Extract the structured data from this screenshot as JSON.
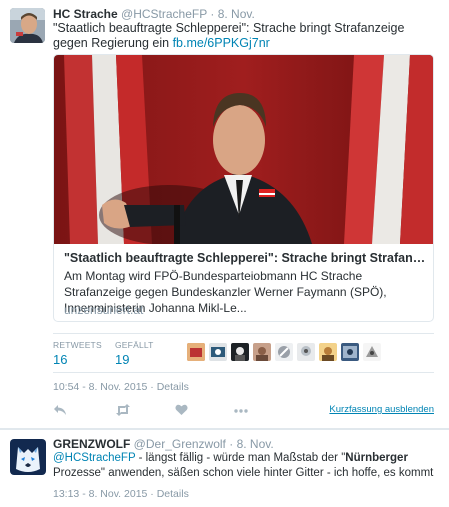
{
  "tweet": {
    "name": "HC Strache",
    "handle": "@HCStracheFP",
    "dot": "·",
    "date": "8. Nov.",
    "text": "\"Staatlich beauftragte Schlepperei\": Strache bringt Strafanzeige gegen Regierung ein",
    "link": "fb.me/6PPKGj7nr",
    "card": {
      "title": "\"Staatlich beauftragte Schlepperei\": Strache bringt Strafanzeige geg...",
      "description": "Am Montag wird FPÖ-Bundesparteiobmann HC Strache Strafanzeige gegen Bundeskanzler Werner Faymann (SPÖ), Innenministerin Johanna Mikl-Le...",
      "domain": "unzensuriert.at"
    },
    "stats": {
      "retweets_label": "RETWEETS",
      "retweets_value": "16",
      "likes_label": "GEFÄLLT",
      "likes_value": "19"
    },
    "timestamp": "10:54 - 8. Nov. 2015",
    "details": "Details",
    "collapse": "Kurzfassung ausblenden"
  },
  "reply": {
    "name": "GRENZWOLF",
    "handle": "@Der_Grenzwolf",
    "dot": "·",
    "date": "8. Nov.",
    "mention": "@HCStracheFP",
    "text_part1": " - längst fällig - würde man Maßstab der \"",
    "text_bold": "Nürnberger",
    "text_part2": " Prozesse\" anwenden, säßen schon viele hinter Gitter - ich hoffe, es kommt",
    "timestamp": "13:13 - 8. Nov. 2015",
    "details": "Details"
  },
  "colors": {
    "link": "#0084b4",
    "muted": "#8899a6",
    "text": "#292f33",
    "border": "#e1e8ed"
  },
  "icons": [
    "reply-icon",
    "retweet-icon",
    "like-icon",
    "more-icon"
  ]
}
